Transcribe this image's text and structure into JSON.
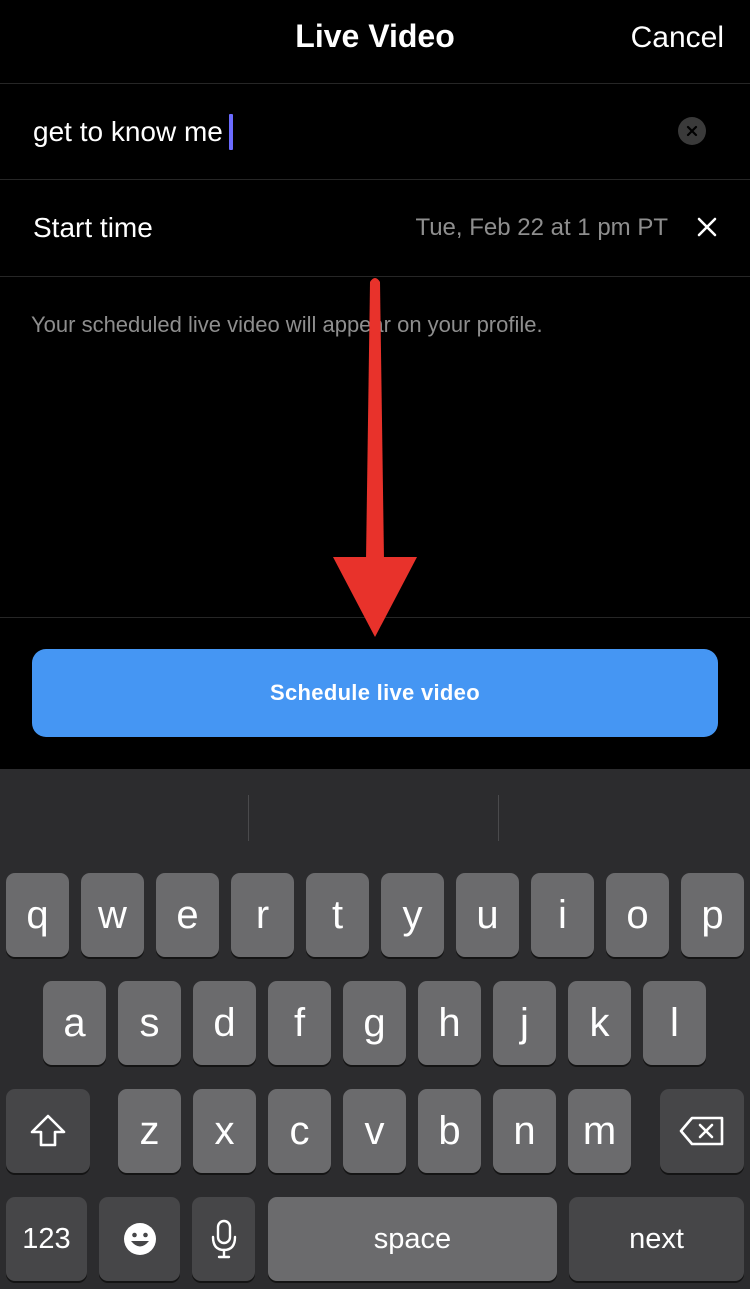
{
  "header": {
    "title": "Live Video",
    "cancel_label": "Cancel"
  },
  "title_field": {
    "value": "get to know me"
  },
  "start_time": {
    "label": "Start time",
    "value": "Tue, Feb 22 at 1 pm PT"
  },
  "helper_text": "Your scheduled live video will appear on your profile.",
  "schedule_button": {
    "label": "Schedule live video"
  },
  "colors": {
    "accent": "#4596f3",
    "caret": "#6b6bff",
    "annotation_arrow": "#e8322b",
    "keyboard_bg": "#2c2c2e",
    "key_bg": "#6b6b6d"
  },
  "keyboard": {
    "row1": [
      "q",
      "w",
      "e",
      "r",
      "t",
      "y",
      "u",
      "i",
      "o",
      "p"
    ],
    "row2": [
      "a",
      "s",
      "d",
      "f",
      "g",
      "h",
      "j",
      "k",
      "l"
    ],
    "row3": [
      "z",
      "x",
      "c",
      "v",
      "b",
      "n",
      "m"
    ],
    "shift_icon": "shift-icon",
    "backspace_icon": "backspace-icon",
    "numbers_label": "123",
    "emoji_icon": "emoji-icon",
    "mic_icon": "microphone-icon",
    "space_label": "space",
    "next_label": "next"
  }
}
